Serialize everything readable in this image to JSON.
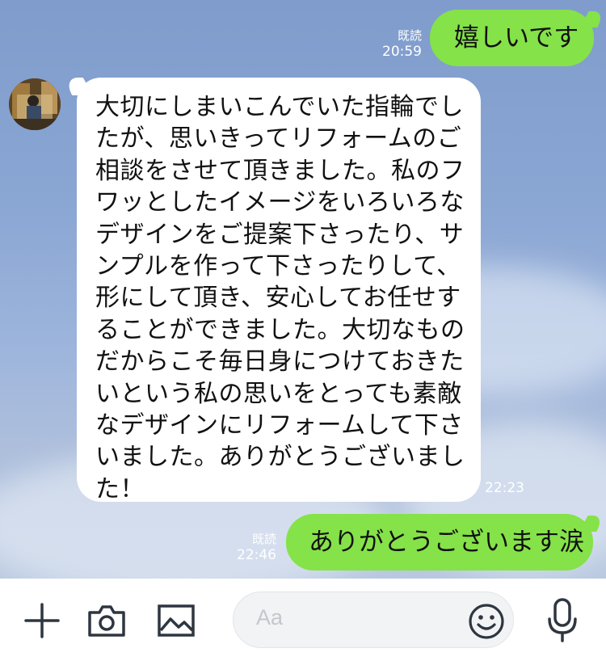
{
  "messages": [
    {
      "side": "out",
      "text": "嬉しいです",
      "read": "既読",
      "time": "20:59"
    },
    {
      "side": "in",
      "text": "大切にしまいこんでいた指輪でし\nたが、思いきってリフォームのご\n相談をさせて頂きました。私のフ\nワッとしたイメージをいろいろな\nデザインをご提案下さったり、サ\nンプルを作って下さったりして、\n形にして頂き、安心してお任せす\nることができました。大切なもの\nだからこそ毎日身につけておきた\nいという私の思いをとっても素敵\nなデザインにリフォームして下さ\nいました。ありがとうございまし\nた！",
      "time": "22:23"
    },
    {
      "side": "out",
      "text": "ありがとうございます涙",
      "read": "既読",
      "time": "22:46"
    }
  ],
  "input": {
    "placeholder": "Aa"
  },
  "toolbar": {
    "icons": [
      "plus-icon",
      "camera-icon",
      "image-icon",
      "emoji-icon",
      "mic-icon"
    ]
  },
  "colors": {
    "outgoing_bubble": "#85e249",
    "incoming_bubble": "#ffffff",
    "icon": "#2e3640"
  }
}
